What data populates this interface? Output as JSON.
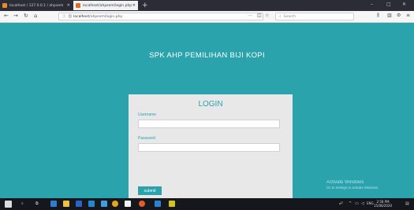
{
  "browser": {
    "tabs": [
      {
        "label": "localhost / 127.0.0.1 / ahpsem",
        "active": false
      },
      {
        "label": "localhost/ahpsem/login.php",
        "active": true
      }
    ],
    "new_tab_symbol": "+",
    "url": {
      "host": "localhost",
      "path": "/ahpsem/login.php"
    },
    "url_menu_symbol": "···",
    "search_placeholder": "Search",
    "window_controls": {
      "minimize": "–",
      "maximize": "□",
      "close": "✕"
    }
  },
  "page": {
    "title": "SPK AHP PEMILIHAN BIJI KOPI",
    "login": {
      "heading": "LOGIN",
      "username_label": "Username",
      "username_value": "",
      "password_label": "Password",
      "password_value": "",
      "submit_label": "submit"
    }
  },
  "watermark": {
    "line1": "Activate Windows",
    "line2": "Go to Settings to activate Windows."
  },
  "taskbar": {
    "clock_time": "2:58 PM",
    "clock_date": "15/06/2020",
    "lang": "ENG"
  },
  "colors": {
    "page_bg": "#2aa3ad",
    "card_bg": "#e8e8e8",
    "accent": "#2aa3ad",
    "tabbar_bg": "#2a2c36",
    "taskbar_bg": "#15171c"
  }
}
